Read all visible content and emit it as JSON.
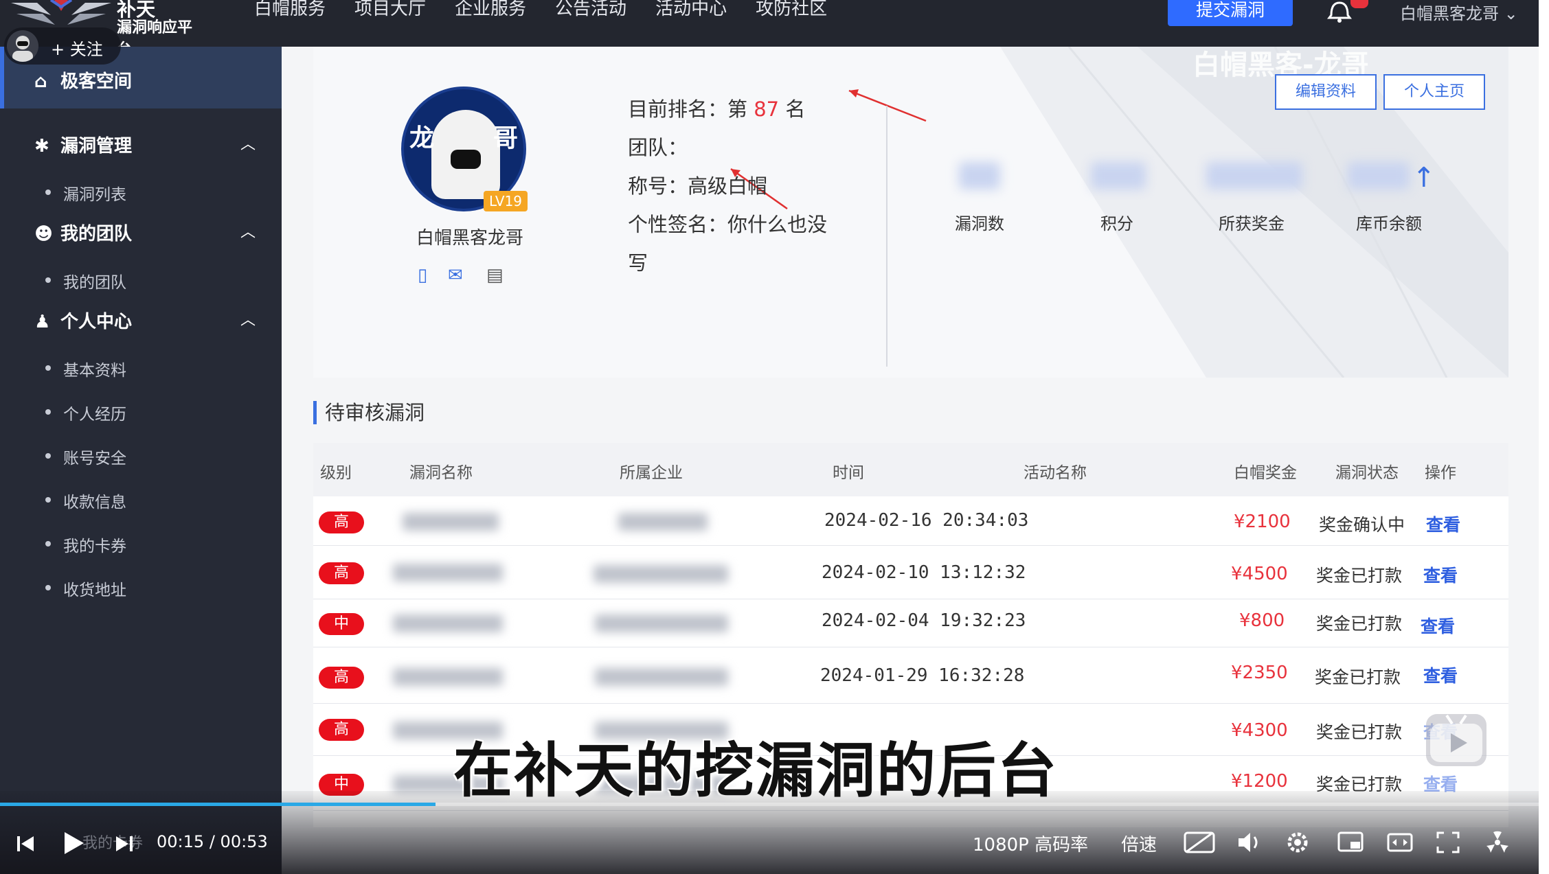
{
  "topnav": {
    "logo_title": "补天",
    "logo_sub": "漏洞响应平台",
    "items": [
      "白帽服务",
      "项目大厅",
      "企业服务",
      "公告活动",
      "活动中心",
      "攻防社区"
    ],
    "submit_label": "提交漏洞",
    "user_label": "白帽黑客龙哥 ⌄"
  },
  "follow": {
    "label": "+ 关注"
  },
  "sidebar": {
    "active": "极客空间",
    "groups": [
      {
        "title": "漏洞管理",
        "items": [
          "漏洞列表"
        ]
      },
      {
        "title": "我的团队",
        "items": [
          "我的团队"
        ]
      },
      {
        "title": "个人中心",
        "items": [
          "基本资料",
          "个人经历",
          "账号安全",
          "收款信息",
          "我的卡券",
          "收货地址"
        ]
      }
    ],
    "ghost_item": "我的卡券"
  },
  "profile": {
    "avatar_glyphs": [
      "龙",
      "哥"
    ],
    "level": "LV19",
    "nickname": "白帽黑客龙哥",
    "rank_prefix": "目前排名：第",
    "rank_value": "87",
    "rank_suffix": "名",
    "team_label": "团队：",
    "title_line": "称号：高级白帽",
    "signature_line1": "个性签名：你什么也没",
    "signature_line2": "写",
    "stats": [
      "漏洞数",
      "积分",
      "所获奖金",
      "库币余额"
    ],
    "edit_button": "编辑资料",
    "home_button": "个人主页",
    "watermark": "白帽黑客-龙哥"
  },
  "pending": {
    "title": "待审核漏洞",
    "columns": [
      "级别",
      "漏洞名称",
      "所属企业",
      "时间",
      "活动名称",
      "白帽奖金",
      "漏洞状态",
      "操作"
    ],
    "rows": [
      {
        "level": "高",
        "time": "2024-02-16 20:34:03",
        "reward": "¥2100",
        "status": "奖金确认中",
        "action": "查看"
      },
      {
        "level": "高",
        "time": "2024-02-10 13:12:32",
        "reward": "¥4500",
        "status": "奖金已打款",
        "action": "查看"
      },
      {
        "level": "中",
        "time": "2024-02-04 19:32:23",
        "reward": "¥800",
        "status": "奖金已打款",
        "action": "查看"
      },
      {
        "level": "高",
        "time": "2024-01-29 16:32:28",
        "reward": "¥2350",
        "status": "奖金已打款",
        "action": "查看"
      },
      {
        "level": "高",
        "time": "",
        "reward": "¥4300",
        "status": "奖金已打款",
        "action": "查看"
      },
      {
        "level": "中",
        "time": "",
        "reward": "¥1200",
        "status": "奖金已打款",
        "action": "查看"
      }
    ]
  },
  "subtitle": "在补天的挖漏洞的后台",
  "player": {
    "current_time": "00:15",
    "separator": "/",
    "duration": "00:53",
    "progress_fraction": 0.283,
    "quality": "1080P 高码率",
    "speed": "倍速"
  },
  "colors": {
    "accent": "#3a6fe0",
    "danger": "#e8323c",
    "sidebar": "#262a36",
    "progress": "#2aa8e6"
  }
}
